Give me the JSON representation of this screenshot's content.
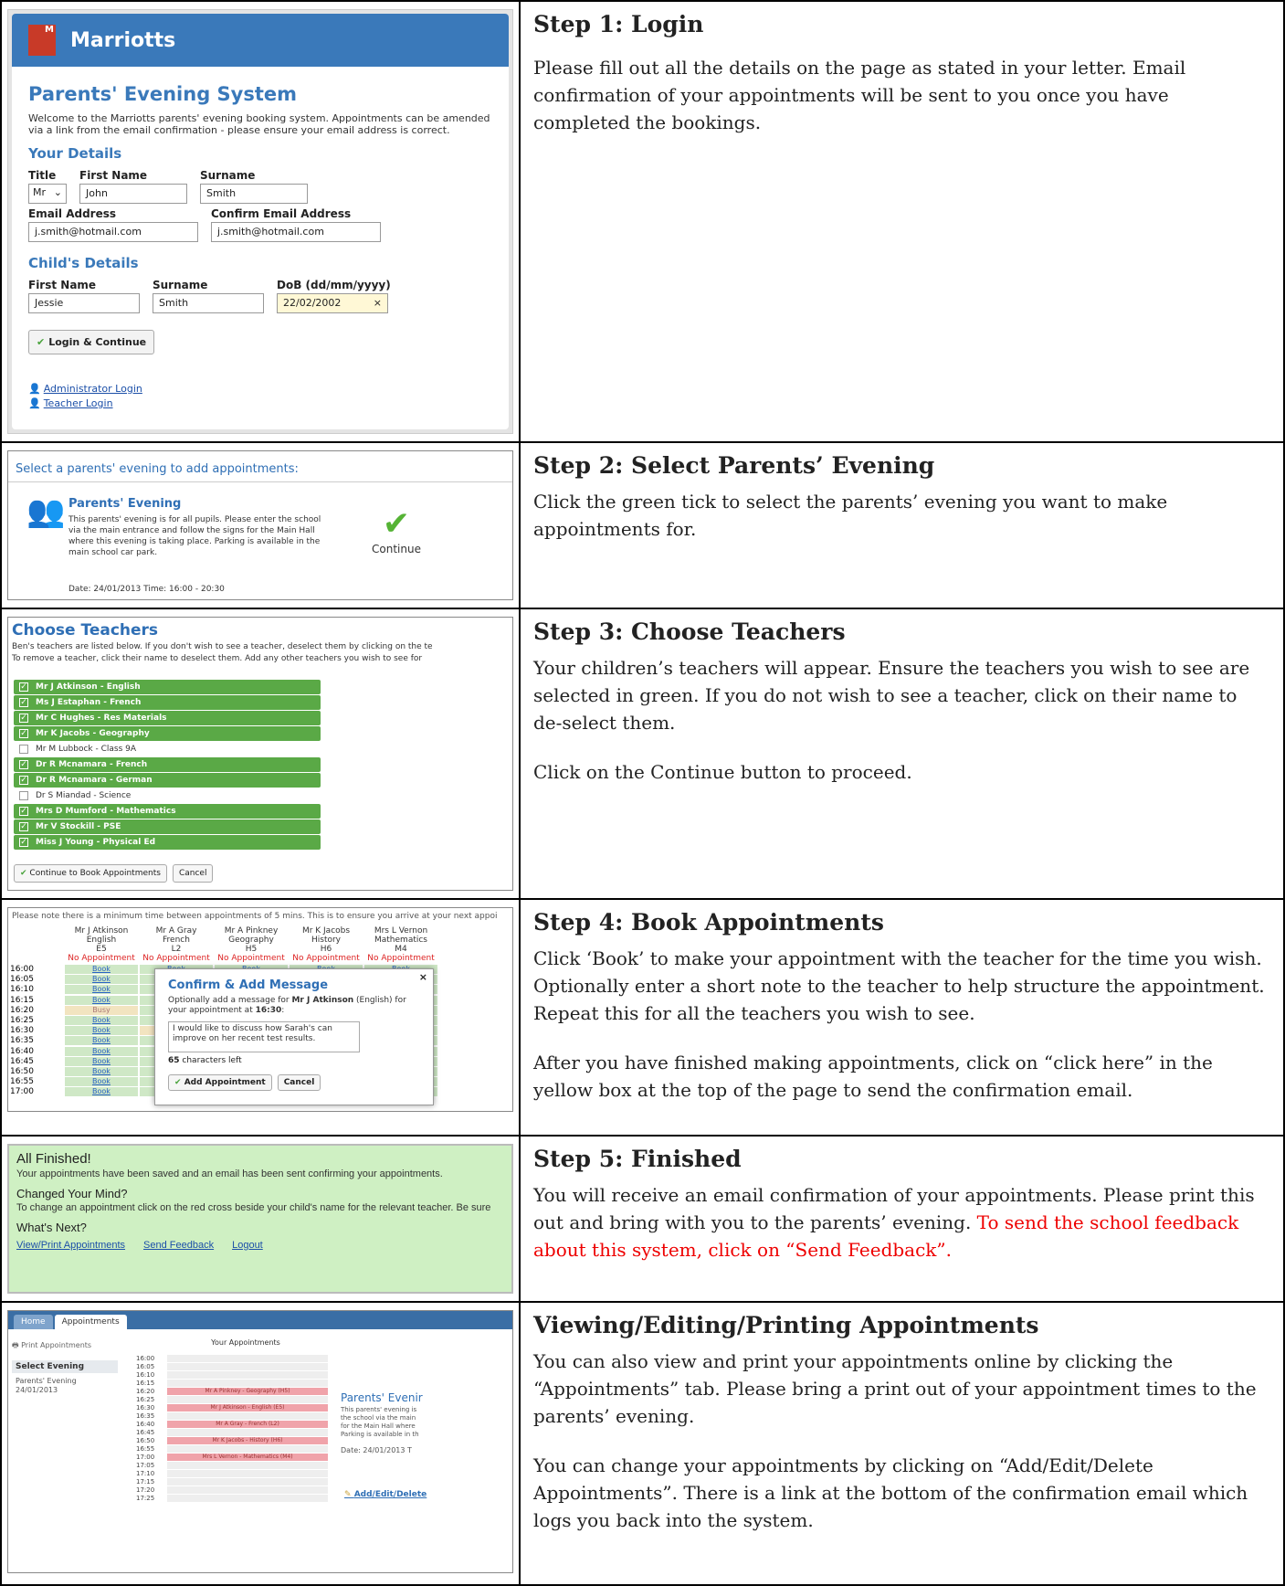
{
  "rows": [
    {
      "heading": "Step 1: Login",
      "paragraphs": [
        "Please fill out all the details on the page as stated in your letter.  Email confirmation of your appointments will be sent to you once you have completed the bookings."
      ]
    },
    {
      "heading": "Step 2: Select Parents’ Evening",
      "paragraphs": [
        "Click the green tick to select the parents’ evening you want to make appointments for."
      ]
    },
    {
      "heading": "Step 3: Choose Teachers",
      "paragraphs": [
        "Your children’s teachers will appear. Ensure the teachers you wish to see are selected in green. If you do not wish to see a teacher, click on their name to de-select them.",
        "Click on the Continue button to proceed."
      ]
    },
    {
      "heading": "Step 4: Book Appointments",
      "paragraphs": [
        "Click ‘Book’ to make your appointment with the teacher for the time you wish. Optionally enter a short note to the teacher to help structure the appointment. Repeat this for all the teachers you wish to see.",
        "After you have finished making appointments, click on “click here” in the yellow box at the top of the page to send the confirmation email."
      ]
    },
    {
      "heading": "Step 5: Finished",
      "paragraphs": [
        "You will receive an email confirmation of your appointments. Please print this out and bring with you to the parents’ evening."
      ],
      "red_note": "To send the school feedback about this system, click on “Send Feedback”."
    },
    {
      "heading": "Viewing/Editing/Printing Appointments",
      "paragraphs": [
        "You can also view and print your appointments online by clicking the “Appointments” tab. Please bring a print out of your appointment times to the parents’ evening.",
        "You can change your appointments by clicking on “Add/Edit/Delete Appointments”. There is a link at the bottom of the confirmation email which logs you back into the system."
      ]
    }
  ],
  "login": {
    "brand": "Marriotts",
    "title": "Parents' Evening System",
    "intro": "Welcome to the Marriotts parents' evening booking system. Appointments can be amended via a link from the email confirmation - please ensure your email address is correct.",
    "your_details": "Your Details",
    "title_label": "Title",
    "title_value": "Mr",
    "first_name_label": "First Name",
    "first_name_value": "John",
    "surname_label": "Surname",
    "surname_value": "Smith",
    "email_label": "Email Address",
    "email_value": "j.smith@hotmail.com",
    "confirm_email_label": "Confirm Email Address",
    "confirm_email_value": "j.smith@hotmail.com",
    "childs_details": "Child's Details",
    "child_first_label": "First Name",
    "child_first_value": "Jessie",
    "child_surname_label": "Surname",
    "child_surname_value": "Smith",
    "dob_label": "DoB (dd/mm/yyyy)",
    "dob_value": "22/02/2002",
    "login_button": "Login & Continue",
    "admin_login": "Administrator Login",
    "teacher_login": "Teacher Login"
  },
  "select_evening": {
    "heading": "Select a parents' evening to add appointments:",
    "event_title": "Parents' Evening",
    "event_desc": "This parents' evening is for all pupils. Please enter the school via the main entrance and follow the signs for the Main Hall where this evening is taking place. Parking is available in the main school car park.",
    "date_time": "Date: 24/01/2013     Time: 16:00 - 20:30",
    "continue_label": "Continue"
  },
  "choose_teachers": {
    "title": "Choose Teachers",
    "intro_1": "Ben's teachers are listed below. If you don't wish to see a teacher, deselect them by clicking on the te",
    "intro_2": "To remove a teacher, click their name to deselect them. Add any other teachers you wish to see for",
    "teachers": [
      {
        "name": "Mr J Atkinson - English",
        "selected": true
      },
      {
        "name": "Ms J Estaphan - French",
        "selected": true
      },
      {
        "name": "Mr C Hughes - Res Materials",
        "selected": true
      },
      {
        "name": "Mr K Jacobs - Geography",
        "selected": true
      },
      {
        "name": "Mr M Lubbock - Class 9A",
        "selected": false
      },
      {
        "name": "Dr R Mcnamara - French",
        "selected": true
      },
      {
        "name": "Dr R Mcnamara - German",
        "selected": true
      },
      {
        "name": "Dr S Miandad - Science",
        "selected": false
      },
      {
        "name": "Mrs D Mumford - Mathematics",
        "selected": true
      },
      {
        "name": "Mr V Stockill - PSE",
        "selected": true
      },
      {
        "name": "Miss J Young - Physical Ed",
        "selected": true
      }
    ],
    "continue_button": "Continue to Book Appointments",
    "cancel_button": "Cancel"
  },
  "book": {
    "note": "Please note there is a minimum time between appointments of 5 mins.  This is to ensure you arrive at your next appoi",
    "teachers": [
      {
        "name": "Mr J Atkinson",
        "subject": "English",
        "room": "E5"
      },
      {
        "name": "Mr A Gray",
        "subject": "French",
        "room": "L2"
      },
      {
        "name": "Mr A Pinkney",
        "subject": "Geography",
        "room": "H5"
      },
      {
        "name": "Mr K Jacobs",
        "subject": "History",
        "room": "H6"
      },
      {
        "name": "Mrs L Vernon",
        "subject": "Mathematics",
        "room": "M4"
      }
    ],
    "no_appointment": "No Appointment",
    "times": [
      "16:00",
      "16:05",
      "16:10",
      "16:15",
      "16:20",
      "16:25",
      "16:30",
      "16:35",
      "16:40",
      "16:45",
      "16:50",
      "16:55",
      "17:00"
    ],
    "book_label": "Book",
    "busy_label": "Busy",
    "modal_title": "Confirm & Add Message",
    "modal_text_1": "Optionally add a message for ",
    "modal_teacher": "Mr J Atkinson",
    "modal_text_2": " (English) for your appointment at ",
    "modal_time": "16:30",
    "modal_message": "I would like to discuss how Sarah's can improve on her recent test results.",
    "chars_left_count": "65",
    "chars_left_label": "characters left",
    "add_button": "Add Appointment",
    "cancel_button": "Cancel",
    "close_icon": "×"
  },
  "finished": {
    "title": "All Finished!",
    "saved": "Your appointments have been saved and an email has been sent confirming your appointments.",
    "changed_title": "Changed Your Mind?",
    "changed_text": "To change an appointment click on the red cross beside your child's name for the relevant teacher. Be sure",
    "next_title": "What's Next?",
    "link_view": "View/Print Appointments",
    "link_feedback": "Send Feedback",
    "link_logout": "Logout"
  },
  "appointments": {
    "tab_home": "Home",
    "tab_appointments": "Appointments",
    "print": "Print Appointments",
    "select_evening": "Select Evening",
    "evening_name": "Parents' Evening",
    "evening_date": "24/01/2013",
    "your_appointments": "Your Appointments",
    "slots": [
      {
        "time": "16:00",
        "label": ""
      },
      {
        "time": "16:05",
        "label": ""
      },
      {
        "time": "16:10",
        "label": ""
      },
      {
        "time": "16:15",
        "label": ""
      },
      {
        "time": "16:20",
        "label": "Mr A Pinkney - Geography (H5)"
      },
      {
        "time": "16:25",
        "label": ""
      },
      {
        "time": "16:30",
        "label": "Mr J Atkinson - English (E5)"
      },
      {
        "time": "16:35",
        "label": ""
      },
      {
        "time": "16:40",
        "label": "Mr A Gray - French (L2)"
      },
      {
        "time": "16:45",
        "label": ""
      },
      {
        "time": "16:50",
        "label": "Mr K Jacobs - History (H6)"
      },
      {
        "time": "16:55",
        "label": ""
      },
      {
        "time": "17:00",
        "label": "Mrs L Vernon - Mathematics (M4)"
      },
      {
        "time": "17:05",
        "label": ""
      },
      {
        "time": "17:10",
        "label": ""
      },
      {
        "time": "17:15",
        "label": ""
      },
      {
        "time": "17:20",
        "label": ""
      },
      {
        "time": "17:25",
        "label": ""
      }
    ],
    "panel_title": "Parents' Evenir",
    "panel_desc_1": "This parents' evening is",
    "panel_desc_2": "the school via the main",
    "panel_desc_3": "for the Main Hall where",
    "panel_desc_4": "Parking is available in th",
    "panel_date": "Date: 24/01/2013     T",
    "edit_link": "Add/Edit/Delete"
  },
  "colors": {
    "brand_blue": "#3a79ba",
    "selected_green": "#5aa946",
    "bookable_green": "#cfe8c6",
    "finished_bg": "#cff0c3",
    "appointment_pink": "#f0a3aa",
    "red_text": "#ee0000"
  }
}
